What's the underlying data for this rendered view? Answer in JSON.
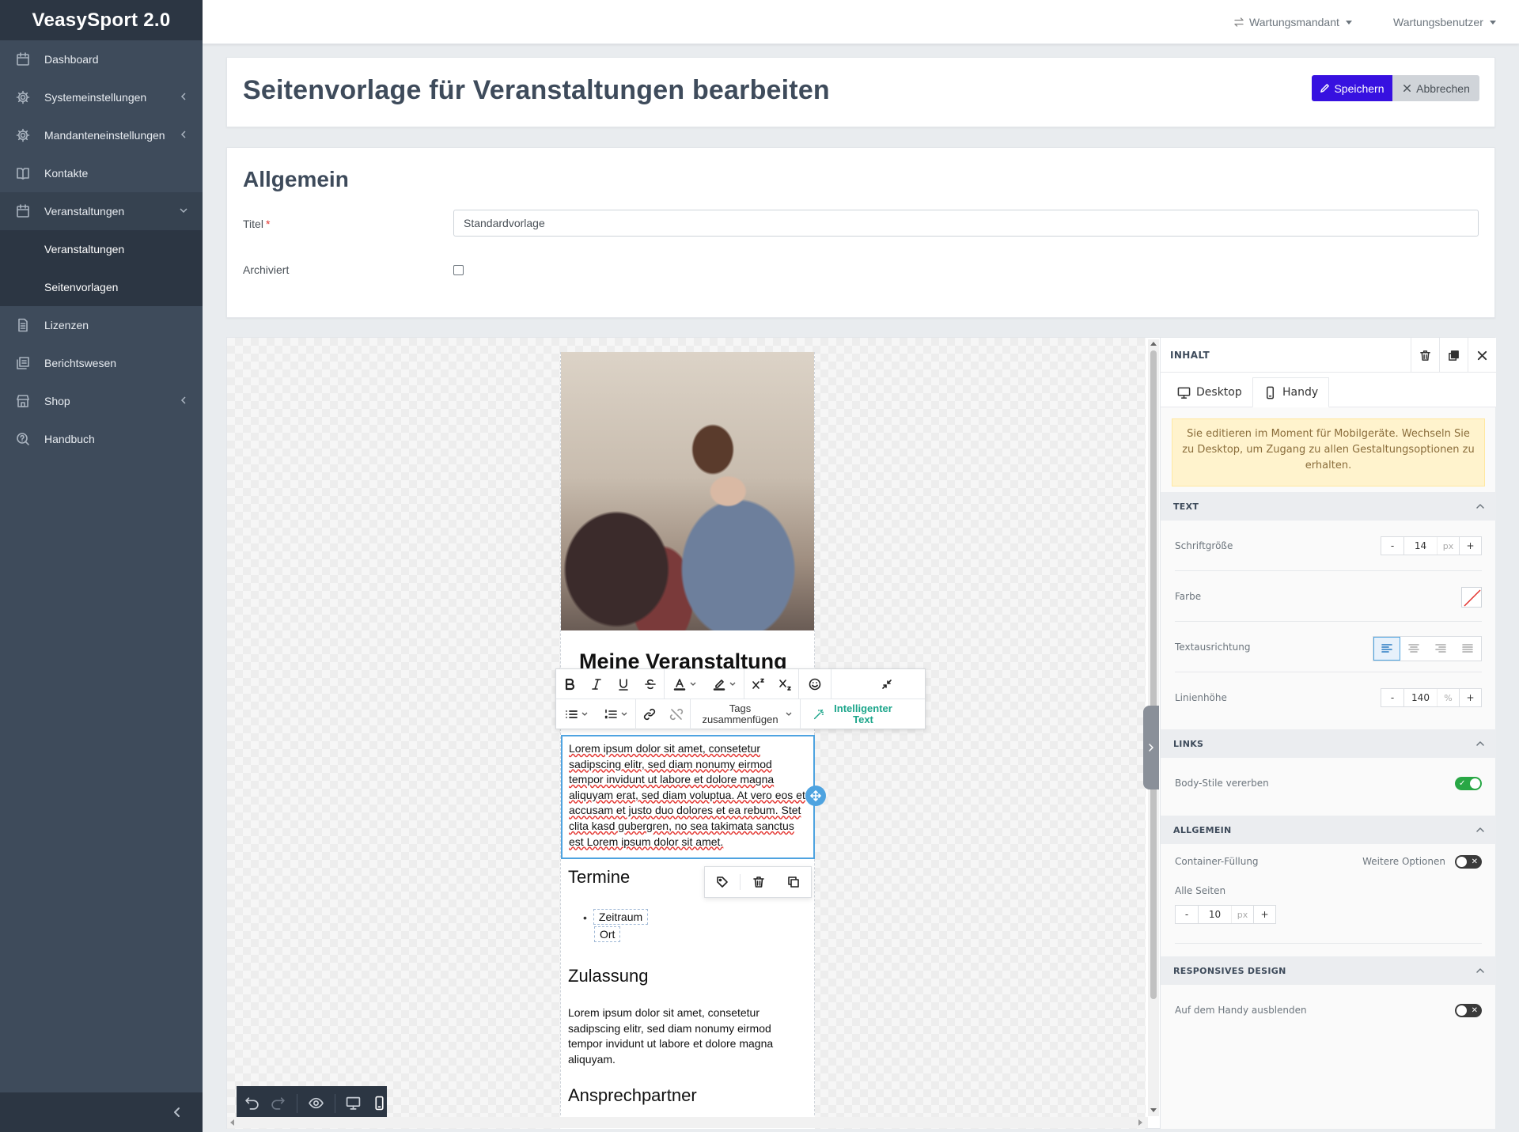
{
  "app": {
    "brand": "VeasySport 2.0"
  },
  "sidebar": {
    "items": [
      {
        "label": "Dashboard",
        "icon": "calendar-icon"
      },
      {
        "label": "Systemeinstellungen",
        "icon": "gear-icon"
      },
      {
        "label": "Mandanteneinstellungen",
        "icon": "gear-icon"
      },
      {
        "label": "Kontakte",
        "icon": "book-icon"
      },
      {
        "label": "Veranstaltungen",
        "icon": "calendar-icon"
      },
      {
        "label": "Lizenzen",
        "icon": "document-icon"
      },
      {
        "label": "Berichtswesen",
        "icon": "layers-icon"
      },
      {
        "label": "Shop",
        "icon": "store-icon"
      },
      {
        "label": "Handbuch",
        "icon": "help-icon"
      }
    ],
    "subitems": [
      {
        "label": "Veranstaltungen"
      },
      {
        "label": "Seitenvorlagen"
      }
    ]
  },
  "topbar": {
    "tenant": "Wartungsmandant",
    "user": "Wartungsbenutzer"
  },
  "header": {
    "title": "Seitenvorlage für Veranstaltungen bearbeiten",
    "save_label": "Speichern",
    "cancel_label": "Abbrechen"
  },
  "general": {
    "section_title": "Allgemein",
    "title_label": "Titel",
    "required_marker": "*",
    "title_value": "Standardvorlage",
    "archived_label": "Archiviert",
    "archived_checked": false
  },
  "document": {
    "event_title": "Meine Veranstaltung",
    "rte": {
      "merge_tags_label": "Tags zusammenfügen",
      "smart_text_label": "Intelligenter Text"
    },
    "editable_text": "Lorem ipsum dolor sit amet, consetetur sadipscing elitr, sed diam nonumy eirmod tempor invidunt ut labore et dolore magna aliquyam erat, sed diam voluptua. At vero eos et accusam et justo duo dolores et ea rebum. Stet clita kasd gubergren, no sea takimata sanctus est Lorem ipsum dolor sit amet.",
    "heading_termine": "Termine",
    "tag_zeitraum": "Zeitraum",
    "tag_ort": "Ort",
    "heading_zulassung": "Zulassung",
    "zulassung_text": "Lorem ipsum dolor sit amet, consetetur sadipscing elitr, sed diam nonumy eirmod tempor invidunt ut labore et dolore magna aliquyam.",
    "heading_ansprechpartner": "Ansprechpartner"
  },
  "panel": {
    "title": "INHALT",
    "tabs": {
      "desktop": "Desktop",
      "mobile": "Handy",
      "active": "mobile"
    },
    "notice": "Sie editieren im Moment für Mobilgeräte. Wechseln Sie zu Desktop, um Zugang zu allen Gestaltungsoptionen zu erhalten.",
    "text_section": {
      "title": "TEXT",
      "font_size_label": "Schriftgröße",
      "font_size_value": "14",
      "font_size_unit": "px",
      "color_label": "Farbe",
      "align_label": "Textausrichtung",
      "align_active": "left",
      "line_height_label": "Linienhöhe",
      "line_height_value": "140",
      "line_height_unit": "%"
    },
    "links_section": {
      "title": "LINKS",
      "inherit_label": "Body-Stile vererben",
      "inherit_on": true
    },
    "general_section": {
      "title": "ALLGEMEIN",
      "padding_label": "Container-Füllung",
      "more_options_label": "Weitere Optionen",
      "more_options_on": false,
      "all_sides_label": "Alle Seiten",
      "padding_value": "10",
      "padding_unit": "px"
    },
    "responsive_section": {
      "title": "RESPONSIVES DESIGN",
      "hide_mobile_label": "Auf dem Handy ausblenden",
      "hide_mobile_on": false
    },
    "stepper_minus": "-",
    "stepper_plus": "+"
  },
  "colors": {
    "sidebar_bg": "#3e4b5b",
    "primary_button": "#3711e0",
    "selection_border": "#4ea3e0",
    "smart_text": "#1aa58a",
    "toggle_on": "#28a745"
  }
}
